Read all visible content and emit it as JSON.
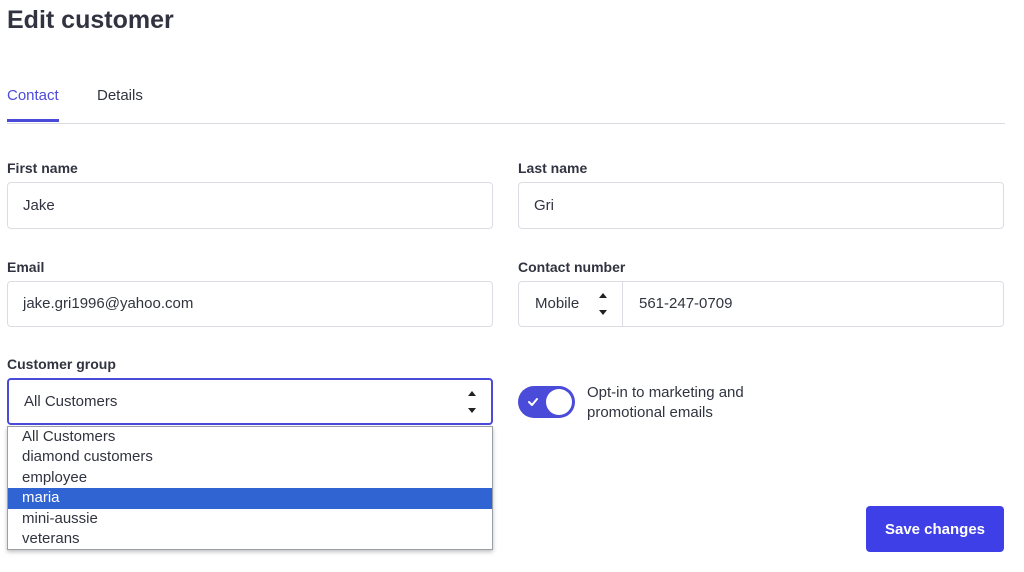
{
  "page": {
    "title": "Edit customer"
  },
  "tabs": [
    {
      "label": "Contact",
      "active": true
    },
    {
      "label": "Details",
      "active": false
    }
  ],
  "form": {
    "first_name": {
      "label": "First name",
      "value": "Jake"
    },
    "last_name": {
      "label": "Last name",
      "value": "Gri"
    },
    "email": {
      "label": "Email",
      "value": "jake.gri1996@yahoo.com"
    },
    "contact_number": {
      "label": "Contact number",
      "type": "Mobile",
      "value": "561-247-0709"
    },
    "customer_group": {
      "label": "Customer group",
      "value": "All Customers",
      "options": [
        "All Customers",
        "diamond customers",
        "employee",
        "maria",
        "mini-aussie",
        "veterans"
      ],
      "highlighted_option": "maria"
    },
    "marketing_optin": {
      "label": "Opt-in to marketing and promotional emails",
      "checked": true
    }
  },
  "actions": {
    "save_label": "Save changes"
  },
  "colors": {
    "accent": "#4b4bd9",
    "highlight": "#2f64d2",
    "text": "#313440",
    "border": "#dcdde3"
  },
  "icons": {
    "select_arrows": "updown-chevron-icon",
    "toggle_check": "check-icon"
  }
}
